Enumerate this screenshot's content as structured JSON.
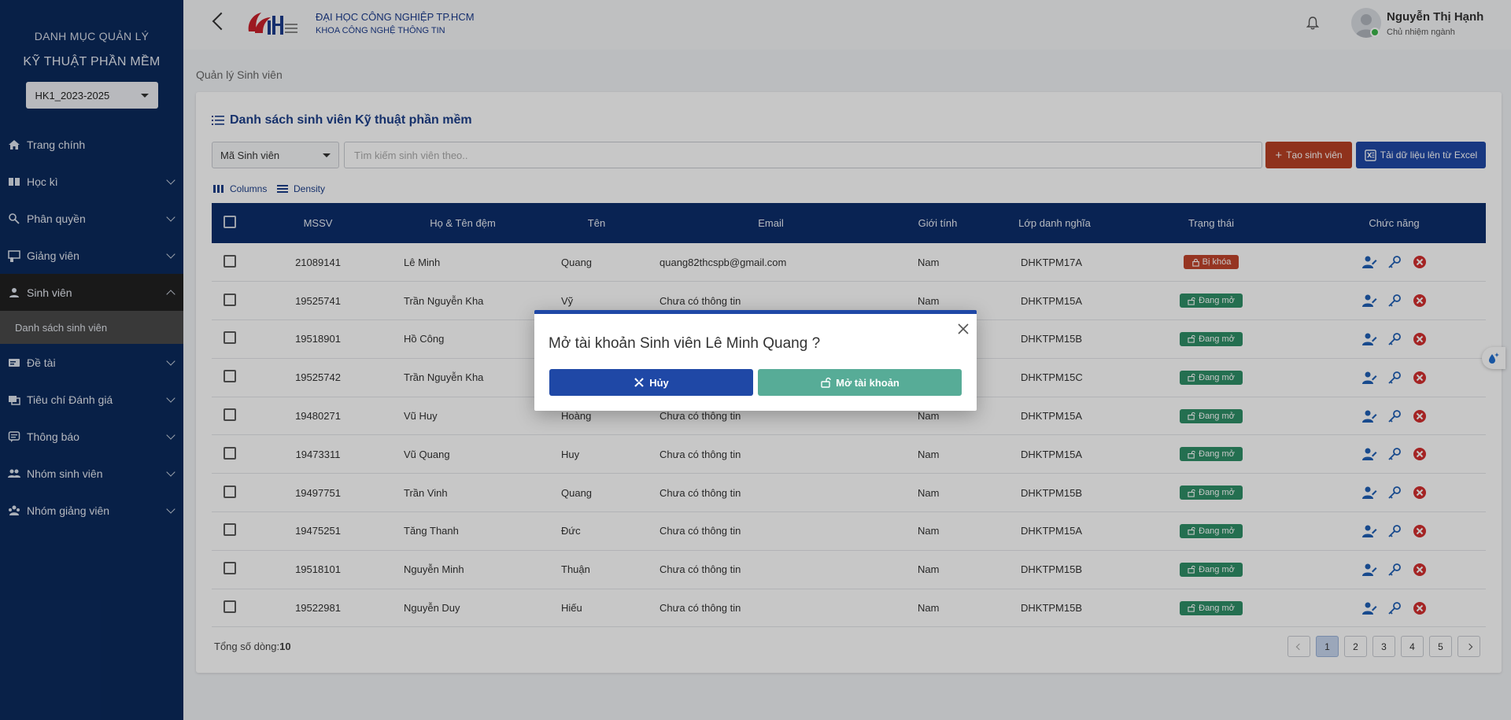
{
  "sidebar": {
    "title_line1": "DANH MỤC QUẢN LÝ",
    "title_line2": "KỸ THUẬT PHẦN MỀM",
    "term": "HK1_2023-2025",
    "items": [
      {
        "label": "Trang chính",
        "icon": "home-icon"
      },
      {
        "label": "Học kì",
        "icon": "book-icon"
      },
      {
        "label": "Phân quyền",
        "icon": "permission-icon"
      },
      {
        "label": "Giảng viên",
        "icon": "teacher-icon"
      },
      {
        "label": "Sinh viên",
        "icon": "student-icon"
      },
      {
        "label": "Đề tài",
        "icon": "topic-icon"
      },
      {
        "label": "Tiêu chí Đánh giá",
        "icon": "criteria-icon"
      },
      {
        "label": "Thông báo",
        "icon": "notification-icon"
      },
      {
        "label": "Nhóm sinh viên",
        "icon": "student-group-icon"
      },
      {
        "label": "Nhóm giảng viên",
        "icon": "teacher-group-icon"
      }
    ],
    "sub_item": "Danh sách sinh viên"
  },
  "header": {
    "uni_name": "ĐẠI HỌC CÔNG NGHIỆP TP.HCM",
    "faculty": "KHOA CÔNG NGHỆ THÔNG TIN",
    "user_name": "Nguyễn Thị Hạnh",
    "user_role": "Chủ nhiệm ngành"
  },
  "main": {
    "breadcrumb": "Quản lý Sinh viên",
    "card_title": "Danh sách sinh viên Kỹ thuật phần mềm",
    "filter_field": "Mã Sinh viên",
    "search_placeholder": "Tìm kiếm sinh viên theo..",
    "create_btn": "Tạo sinh viên",
    "excel_btn": "Tải dữ liệu lên từ Excel",
    "columns_btn": "Columns",
    "density_btn": "Density",
    "table": {
      "headers": [
        "MSSV",
        "Họ & Tên đệm",
        "Tên",
        "Email",
        "Giới tính",
        "Lớp danh nghĩa",
        "Trạng thái",
        "Chức năng"
      ],
      "rows": [
        {
          "mssv": "21089141",
          "ho": "Lê Minh",
          "ten": "Quang",
          "email": "quang82thcspb@gmail.com",
          "gt": "Nam",
          "lop": "DHKTPM17A",
          "status": "Bị khóa",
          "locked": true
        },
        {
          "mssv": "19525741",
          "ho": "Trần Nguyễn Kha",
          "ten": "Vỹ",
          "email": "Chưa có thông tin",
          "gt": "Nam",
          "lop": "DHKTPM15A",
          "status": "Đang mở",
          "locked": false
        },
        {
          "mssv": "19518901",
          "ho": "Hồ Công",
          "ten": "",
          "email": "",
          "gt": "",
          "lop": "DHKTPM15B",
          "status": "Đang mở",
          "locked": false
        },
        {
          "mssv": "19525742",
          "ho": "Trần Nguyễn Kha",
          "ten": "",
          "email": "",
          "gt": "",
          "lop": "DHKTPM15C",
          "status": "Đang mở",
          "locked": false
        },
        {
          "mssv": "19480271",
          "ho": "Vũ Huy",
          "ten": "Hoàng",
          "email": "Chưa có thông tin",
          "gt": "Nam",
          "lop": "DHKTPM15A",
          "status": "Đang mở",
          "locked": false
        },
        {
          "mssv": "19473311",
          "ho": "Vũ Quang",
          "ten": "Huy",
          "email": "Chưa có thông tin",
          "gt": "Nam",
          "lop": "DHKTPM15A",
          "status": "Đang mở",
          "locked": false
        },
        {
          "mssv": "19497751",
          "ho": "Trần Vinh",
          "ten": "Quang",
          "email": "Chưa có thông tin",
          "gt": "Nam",
          "lop": "DHKTPM15B",
          "status": "Đang mở",
          "locked": false
        },
        {
          "mssv": "19475251",
          "ho": "Tăng Thanh",
          "ten": "Đức",
          "email": "Chưa có thông tin",
          "gt": "Nam",
          "lop": "DHKTPM15A",
          "status": "Đang mở",
          "locked": false
        },
        {
          "mssv": "19518101",
          "ho": "Nguyễn Minh",
          "ten": "Thuận",
          "email": "Chưa có thông tin",
          "gt": "Nam",
          "lop": "DHKTPM15B",
          "status": "Đang mở",
          "locked": false
        },
        {
          "mssv": "19522981",
          "ho": "Nguyễn Duy",
          "ten": "Hiếu",
          "email": "Chưa có thông tin",
          "gt": "Nam",
          "lop": "DHKTPM15B",
          "status": "Đang mở",
          "locked": false
        }
      ]
    },
    "total_label": "Tổng số dòng:",
    "total_value": "10",
    "pages": [
      "1",
      "2",
      "3",
      "4",
      "5"
    ],
    "current_page": "1"
  },
  "modal": {
    "title": "Mở tài khoản Sinh viên Lê Minh Quang ?",
    "cancel": "Hủy",
    "confirm": "Mở tài khoản"
  },
  "colors": {
    "sidebar": "#0b2a5c",
    "primary": "#1f48a6",
    "table_header": "#0c2d6b",
    "locked": "#c0442c",
    "open": "#2f8f67",
    "create": "#b84024",
    "confirm": "#57ac97"
  }
}
